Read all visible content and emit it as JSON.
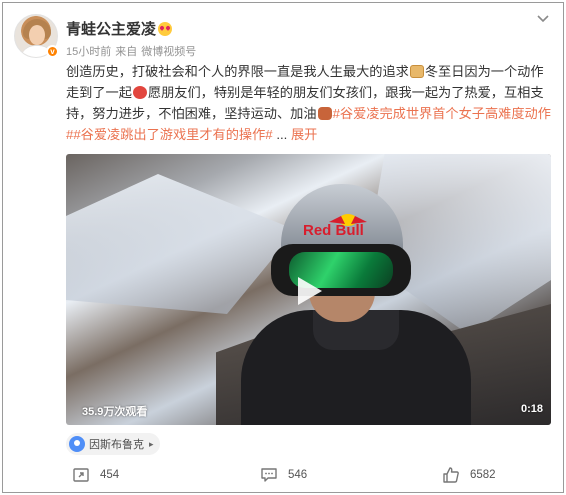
{
  "post": {
    "author": {
      "name": "青蛙公主爱凌",
      "avatar_icon": "avatar",
      "verified_badge": "v",
      "emoji_icon": "heart-eyes-emoji-icon"
    },
    "meta": {
      "time": "15小时前",
      "source_prefix": "来自",
      "source": "微博视频号"
    },
    "text": {
      "line1_a": "创造历史，打破社会和个人的界限一直是我人生最大的追求",
      "line1_b": "冬至日因为一个动作走到",
      "line2_a": "了一起",
      "line2_b": "愿朋友们，特别是年轻的朋友们女孩们，跟我一起为了热爱，互相支持，努力",
      "line3_a": "进步，不怕困难，坚持运动、加油",
      "hashtag1": "#谷爱凌完成世界首个女子高难度动作#",
      "hashtag2": "#谷爱凌跳出了游戏里才有的操作#",
      "ellipsis": "...",
      "expand": "展开"
    },
    "video": {
      "views": "35.9万次观看",
      "duration": "0:18",
      "helmet_brand": "Red Bull"
    },
    "location": {
      "label": "因斯布鲁克",
      "arrow": "▸"
    },
    "actions": {
      "repost_count": "454",
      "comment_count": "546",
      "like_count": "6582"
    }
  },
  "colors": {
    "hashtag": "#eb7350",
    "text": "#333333",
    "meta": "#939393",
    "badge": "#ff8200",
    "location_pin": "#4f8ef7"
  }
}
